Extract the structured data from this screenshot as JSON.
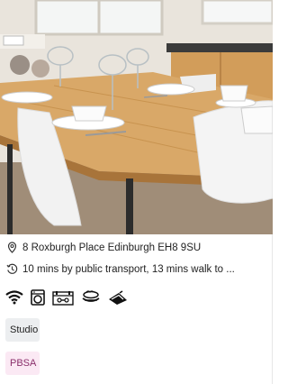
{
  "listing": {
    "image_alt": "Dining table with place settings in a kitchen",
    "address": "8 Roxburgh Place Edinburgh EH8 9SU",
    "commute": "10 mins by public transport, 13 mins walk to ...",
    "amenities": [
      {
        "icon": "wifi-icon"
      },
      {
        "icon": "washing-machine-icon"
      },
      {
        "icon": "gym-icon"
      },
      {
        "icon": "bed-icon"
      },
      {
        "icon": "iron-icon"
      }
    ],
    "tags": [
      "Studio",
      "PBSA"
    ]
  },
  "colors": {
    "studio_tag_bg": "#eceef0",
    "pbsa_tag_bg": "#fbe9f4",
    "pbsa_tag_text": "#8a2f6b"
  }
}
